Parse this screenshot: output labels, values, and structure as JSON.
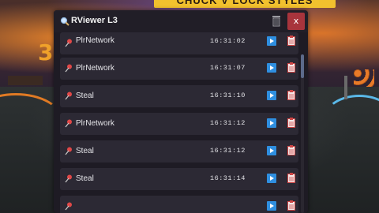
{
  "background": {
    "banner_text": "CHUCK V LOCK STYLES",
    "number_text": "3"
  },
  "window": {
    "title": "RViewer L3",
    "title_icon": "magnifier-icon",
    "clear_icon": "trash-icon",
    "close_label": "x"
  },
  "remotes": [
    {
      "name": "PlrNetwork",
      "time": "16:31:02"
    },
    {
      "name": "PlrNetwork",
      "time": "16:31:07"
    },
    {
      "name": "Steal",
      "time": "16:31:10"
    },
    {
      "name": "PlrNetwork",
      "time": "16:31:12"
    },
    {
      "name": "Steal",
      "time": "16:31:12"
    },
    {
      "name": "Steal",
      "time": "16:31:14"
    },
    {
      "name": "",
      "time": ""
    }
  ],
  "colors": {
    "accent_blue": "#2f8fe0",
    "close_red": "#a8343c",
    "pin_red": "#e04848"
  }
}
